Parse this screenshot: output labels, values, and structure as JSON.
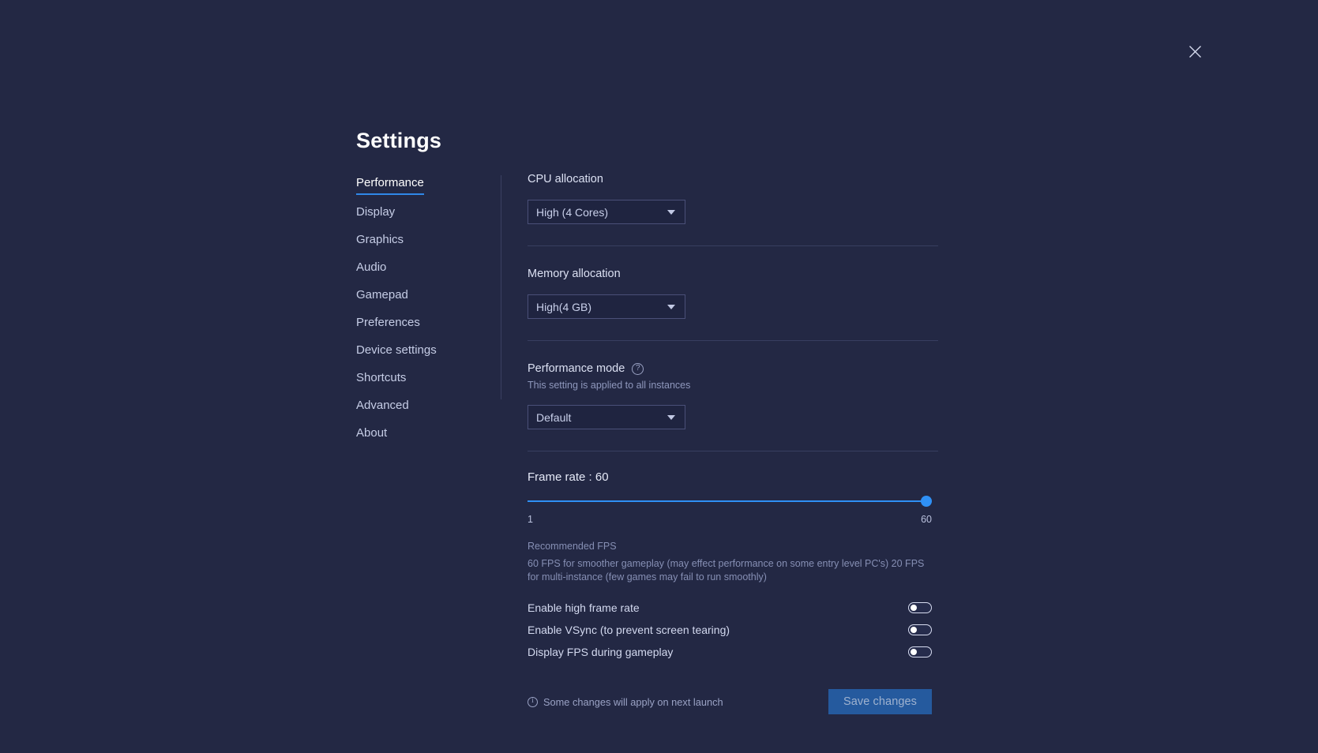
{
  "window": {
    "title": "Settings",
    "close_icon": "close-icon",
    "background_color": "#232844",
    "accent_color": "#2f90f5"
  },
  "sidebar": {
    "items": [
      {
        "label": "Performance",
        "active": true
      },
      {
        "label": "Display",
        "active": false
      },
      {
        "label": "Graphics",
        "active": false
      },
      {
        "label": "Audio",
        "active": false
      },
      {
        "label": "Gamepad",
        "active": false
      },
      {
        "label": "Preferences",
        "active": false
      },
      {
        "label": "Device settings",
        "active": false
      },
      {
        "label": "Shortcuts",
        "active": false
      },
      {
        "label": "Advanced",
        "active": false
      },
      {
        "label": "About",
        "active": false
      }
    ]
  },
  "performance": {
    "cpu": {
      "label": "CPU allocation",
      "value": "High (4 Cores)",
      "options": [
        "High (4 Cores)"
      ]
    },
    "memory": {
      "label": "Memory allocation",
      "value": "High(4 GB)",
      "options": [
        "High(4 GB)"
      ]
    },
    "performance_mode": {
      "label": "Performance mode",
      "help_icon": "help-circle-icon",
      "sublabel": "This setting is applied to all instances",
      "value": "Default",
      "options": [
        "Default"
      ]
    },
    "frame_rate": {
      "title": "Frame rate : 60",
      "value": 60,
      "min": 1,
      "max": 60,
      "min_label": "1",
      "max_label": "60",
      "recommended_title": "Recommended FPS",
      "recommended_body": "60 FPS for smoother gameplay (may effect performance on some entry level PC's) 20 FPS for multi-instance (few games may fail to run smoothly)"
    },
    "toggles": [
      {
        "label": "Enable high frame rate",
        "on": false
      },
      {
        "label": "Enable VSync (to prevent screen tearing)",
        "on": false
      },
      {
        "label": "Display FPS during gameplay",
        "on": false
      }
    ]
  },
  "footer": {
    "info_icon": "info-circle-icon",
    "note": "Some changes will apply on next launch",
    "save_label": "Save changes"
  }
}
